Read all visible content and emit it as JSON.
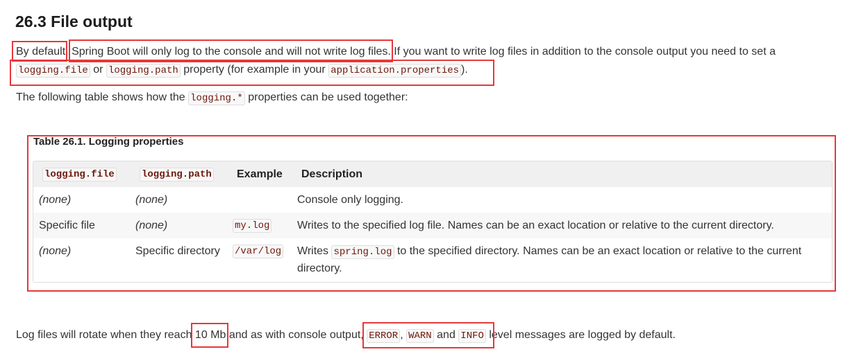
{
  "heading": "26.3 File output",
  "intro": {
    "by_default": "By default",
    "comma": ",",
    "main_clause": "Spring Boot will only log to the console and will not write log files.",
    "rest": " If you want to write log files in addition to the console output you need to set a",
    "code1": "logging.file",
    "or": " or ",
    "code2": "logging.path",
    "middle": " property (for example in your ",
    "code3": "application.properties",
    "end": ")."
  },
  "line3": {
    "before": "The following table shows how the ",
    "code": "logging.*",
    "after": " properties can be used together:"
  },
  "table": {
    "caption": "Table 26.1. Logging properties",
    "headers": {
      "col1": "logging.file",
      "col2": "logging.path",
      "col3": "Example",
      "col4": "Description"
    },
    "rows": [
      {
        "file": "(none)",
        "path": "(none)",
        "example": "",
        "description": "Console only logging."
      },
      {
        "file": "Specific file",
        "path": "(none)",
        "example": "my.log",
        "description": "Writes to the specified log file. Names can be an exact location or relative to the current directory."
      },
      {
        "file": "(none)",
        "path": "Specific directory",
        "example": "/var/log",
        "description_before": "Writes ",
        "description_code": "spring.log",
        "description_after": " to the specified directory. Names can be an exact location or relative to the current",
        "description_line2": "directory."
      }
    ]
  },
  "footer": {
    "before": "Log files will rotate when they reach ",
    "size": "10 Mb",
    "middle": " and as with console output, ",
    "level1": "ERROR",
    "comma": ", ",
    "level2": "WARN",
    "and": " and ",
    "level3": "INFO",
    "after": " level messages are logged by default."
  },
  "colors": {
    "annotation": "#e5383b",
    "code_text": "#6d180b",
    "code_bg": "#f8f8f8"
  }
}
